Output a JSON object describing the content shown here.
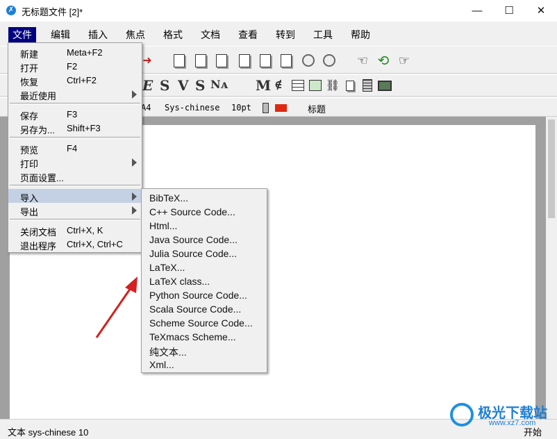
{
  "window": {
    "title": "无标题文件 [2]*",
    "icon": "texmacs-icon",
    "controls": {
      "minimize": "—",
      "maximize": "☐",
      "close": "✕"
    }
  },
  "menubar": {
    "items": [
      {
        "label": "文件",
        "active": true
      },
      {
        "label": "编辑"
      },
      {
        "label": "插入"
      },
      {
        "label": "焦点"
      },
      {
        "label": "格式"
      },
      {
        "label": "文档"
      },
      {
        "label": "查看"
      },
      {
        "label": "转到"
      },
      {
        "label": "工具"
      },
      {
        "label": "帮助"
      }
    ]
  },
  "file_menu": {
    "items": [
      {
        "label": "新建",
        "shortcut": "Meta+F2"
      },
      {
        "label": "打开",
        "shortcut": "F2"
      },
      {
        "label": "恢复",
        "shortcut": "Ctrl+F2"
      },
      {
        "label": "最近使用",
        "submenu": true
      },
      {
        "label": "保存",
        "shortcut": "F3"
      },
      {
        "label": "另存为...",
        "shortcut": "Shift+F3"
      },
      {
        "label": "预览",
        "shortcut": "F4"
      },
      {
        "label": "打印",
        "submenu": true
      },
      {
        "label": "页面设置..."
      },
      {
        "label": "导入",
        "submenu": true,
        "highlighted": true
      },
      {
        "label": "导出",
        "submenu": true
      },
      {
        "label": "关闭文档",
        "shortcut": "Ctrl+X, K"
      },
      {
        "label": "退出程序",
        "shortcut": "Ctrl+X, Ctrl+C"
      }
    ]
  },
  "import_submenu": {
    "items": [
      "BibTeX...",
      "C++ Source Code...",
      "Html...",
      "Java Source Code...",
      "Julia Source Code...",
      "LaTeX...",
      "LaTeX class...",
      "Python Source Code...",
      "Scala Source Code...",
      "Scheme Source Code...",
      "TeXmacs Scheme...",
      "纯文本...",
      "Xml..."
    ]
  },
  "format_bar": {
    "paper": "A4",
    "font": "Sys-chinese",
    "size": "10pt",
    "style": "标题"
  },
  "toolbar2_symbols": [
    "E",
    "S",
    "V",
    "S",
    "Nᴀ",
    "M",
    "∉"
  ],
  "status": {
    "left": "文本 sys-chinese 10",
    "right": "开始"
  },
  "watermark": {
    "text": "极光下载站",
    "url": "www.xz7.com"
  },
  "colors": {
    "menu_active": "#000080",
    "highlight": "#c4d0e4",
    "arrow": "#d42020"
  }
}
